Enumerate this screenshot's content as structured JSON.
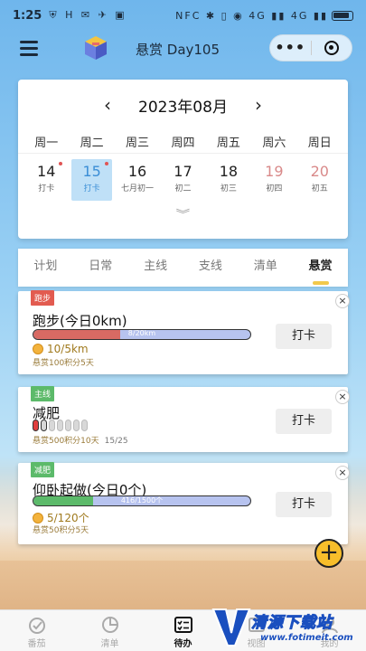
{
  "status_bar": {
    "time": "1:25",
    "left_icons": "⛨ H ✉ ✈ ▣",
    "right_icons": "NFC ✱ ▯ ◉ 4G ▮▮ 4G ▮▮"
  },
  "app": {
    "title": "悬赏 Day105",
    "capsule_more": "•••"
  },
  "calendar": {
    "prev": "‹",
    "next": "›",
    "month": "2023年08月",
    "weekdays": [
      "周一",
      "周二",
      "周三",
      "周四",
      "周五",
      "周六",
      "周日"
    ],
    "days": [
      {
        "num": "14",
        "sub": "打卡",
        "dot": true,
        "today": false,
        "weekend": false
      },
      {
        "num": "15",
        "sub": "打卡",
        "dot": true,
        "today": true,
        "weekend": false
      },
      {
        "num": "16",
        "sub": "七月初一",
        "dot": false,
        "today": false,
        "weekend": false
      },
      {
        "num": "17",
        "sub": "初二",
        "dot": false,
        "today": false,
        "weekend": false
      },
      {
        "num": "18",
        "sub": "初三",
        "dot": false,
        "today": false,
        "weekend": false
      },
      {
        "num": "19",
        "sub": "初四",
        "dot": false,
        "today": false,
        "weekend": true
      },
      {
        "num": "20",
        "sub": "初五",
        "dot": false,
        "today": false,
        "weekend": true
      }
    ],
    "expand": "︾"
  },
  "tabs": [
    "计划",
    "日常",
    "主线",
    "支线",
    "清单",
    "悬赏"
  ],
  "active_tab": "悬赏",
  "tasks": [
    {
      "tag": "跑步",
      "title": "跑步(今日0km)",
      "progress_text": "8/20km",
      "progress_fraction": 0.4,
      "progress_color": "#d86a63",
      "count": "10/5km",
      "reward": "悬赏100积分5天",
      "button": "打卡"
    },
    {
      "tag": "主线",
      "title": "减肥",
      "pills_total": 7,
      "pills_on": 1,
      "reward": "悬赏500积分10天",
      "ratio": "15/25",
      "button": "打卡"
    },
    {
      "tag": "减肥",
      "title": "仰卧起做(今日0个)",
      "progress_text": "416/1500个",
      "progress_fraction": 0.277,
      "progress_color": "#5cba6a",
      "count": "5/120个",
      "reward": "悬赏50积分5天",
      "button": "打卡"
    }
  ],
  "fab": "+",
  "bottom_nav": [
    {
      "label": "番茄",
      "icon": "tomato-icon"
    },
    {
      "label": "清单",
      "icon": "pie-chart-icon"
    },
    {
      "label": "待办",
      "icon": "todo-list-icon"
    },
    {
      "label": "视图",
      "icon": "view-icon"
    },
    {
      "label": "我的",
      "icon": "profile-icon"
    }
  ],
  "watermark": {
    "text": "清源下载站",
    "url": "www.fotimeit.com"
  },
  "colors": {
    "accent_yellow": "#f2c94c",
    "today_bg": "#bfe0f7",
    "tag_red": "#e25b50",
    "tag_green": "#5cba6a",
    "progress_track": "#b7c3ef"
  }
}
